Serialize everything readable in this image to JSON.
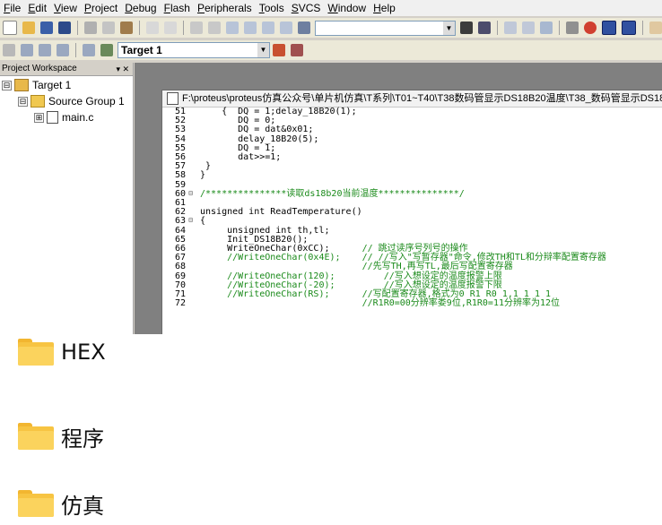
{
  "menu": [
    "File",
    "Edit",
    "View",
    "Project",
    "Debug",
    "Flash",
    "Peripherals",
    "Tools",
    "SVCS",
    "Window",
    "Help"
  ],
  "toolbar": {
    "target_value": "Target 1"
  },
  "workspace": {
    "title": "Project Workspace",
    "controls": "▾ ✕",
    "tree": [
      {
        "label": "Target 1",
        "toggle": "⊟",
        "level": 0
      },
      {
        "label": "Source Group 1",
        "toggle": "⊟",
        "level": 1
      },
      {
        "label": "main.c",
        "toggle": "⊞",
        "level": 2
      }
    ]
  },
  "editor": {
    "title": "F:\\proteus\\proteus仿真公众号\\单片机仿真\\T系列\\T01~T40\\T38数码管显示DS18B20温度\\T38_数码管显示DS18",
    "lines": [
      {
        "n": "51",
        "fold": "",
        "code": "    {  DQ = 1;delay_18B20(1);",
        "cls": ""
      },
      {
        "n": "52",
        "fold": "",
        "code": "       DQ = 0;",
        "cls": ""
      },
      {
        "n": "53",
        "fold": "",
        "code": "       DQ = dat&0x01;",
        "cls": ""
      },
      {
        "n": "54",
        "fold": "",
        "code": "       delay_18B20(5);",
        "cls": ""
      },
      {
        "n": "55",
        "fold": "",
        "code": "       DQ = 1;",
        "cls": ""
      },
      {
        "n": "56",
        "fold": "",
        "code": "       dat>>=1;",
        "cls": ""
      },
      {
        "n": "57",
        "fold": "",
        "code": " }",
        "cls": ""
      },
      {
        "n": "58",
        "fold": "",
        "code": "}",
        "cls": ""
      },
      {
        "n": "59",
        "fold": "",
        "code": "",
        "cls": ""
      },
      {
        "n": "60",
        "fold": "⊟",
        "code": "/***************读取ds18b20当前温度***************/",
        "cls": "cmt"
      },
      {
        "n": "61",
        "fold": "",
        "code": "",
        "cls": ""
      },
      {
        "n": "62",
        "fold": "",
        "code": "unsigned int ReadTemperature()",
        "cls": ""
      },
      {
        "n": "63",
        "fold": "⊟",
        "code": "{",
        "cls": ""
      },
      {
        "n": "64",
        "fold": "",
        "code": "     unsigned int th,tl;",
        "cls": ""
      },
      {
        "n": "65",
        "fold": "",
        "code": "     Init_DS18B20();",
        "cls": ""
      },
      {
        "n": "66",
        "fold": "",
        "code": "     WriteOneChar(0xCC);      // 跳过读序号列号的操作",
        "cls": "mix1"
      },
      {
        "n": "67",
        "fold": "",
        "code": "     //WriteOneChar(0x4E);    // //写入\"写暂存器\"命令,修改TH和TL和分辩率配置寄存器",
        "cls": "cmt"
      },
      {
        "n": "68",
        "fold": "",
        "code": "                              //先写TH,再写TL,最后写配置寄存器",
        "cls": "cmt"
      },
      {
        "n": "69",
        "fold": "",
        "code": "     //WriteOneChar(120);         //写入想设定的温度报警上限",
        "cls": "cmt"
      },
      {
        "n": "70",
        "fold": "",
        "code": "     //WriteOneChar(-20);         //写入想设定的温度报警下限",
        "cls": "cmt"
      },
      {
        "n": "71",
        "fold": "",
        "code": "     //WriteOneChar(RS);      //写配置寄存器,格式为0 R1 R0 1,1 1 1 1",
        "cls": "cmt"
      },
      {
        "n": "72",
        "fold": "",
        "code": "                              //R1R0=00分辨率娄9位,R1R0=11分辨率为12位",
        "cls": "cmt"
      }
    ]
  },
  "folders": [
    {
      "name": "HEX"
    },
    {
      "name": "程序"
    },
    {
      "name": "仿真"
    }
  ],
  "colors": {
    "folder": "#f7c442",
    "comment": "#1a8a1a",
    "keyword": "#0000e0"
  }
}
